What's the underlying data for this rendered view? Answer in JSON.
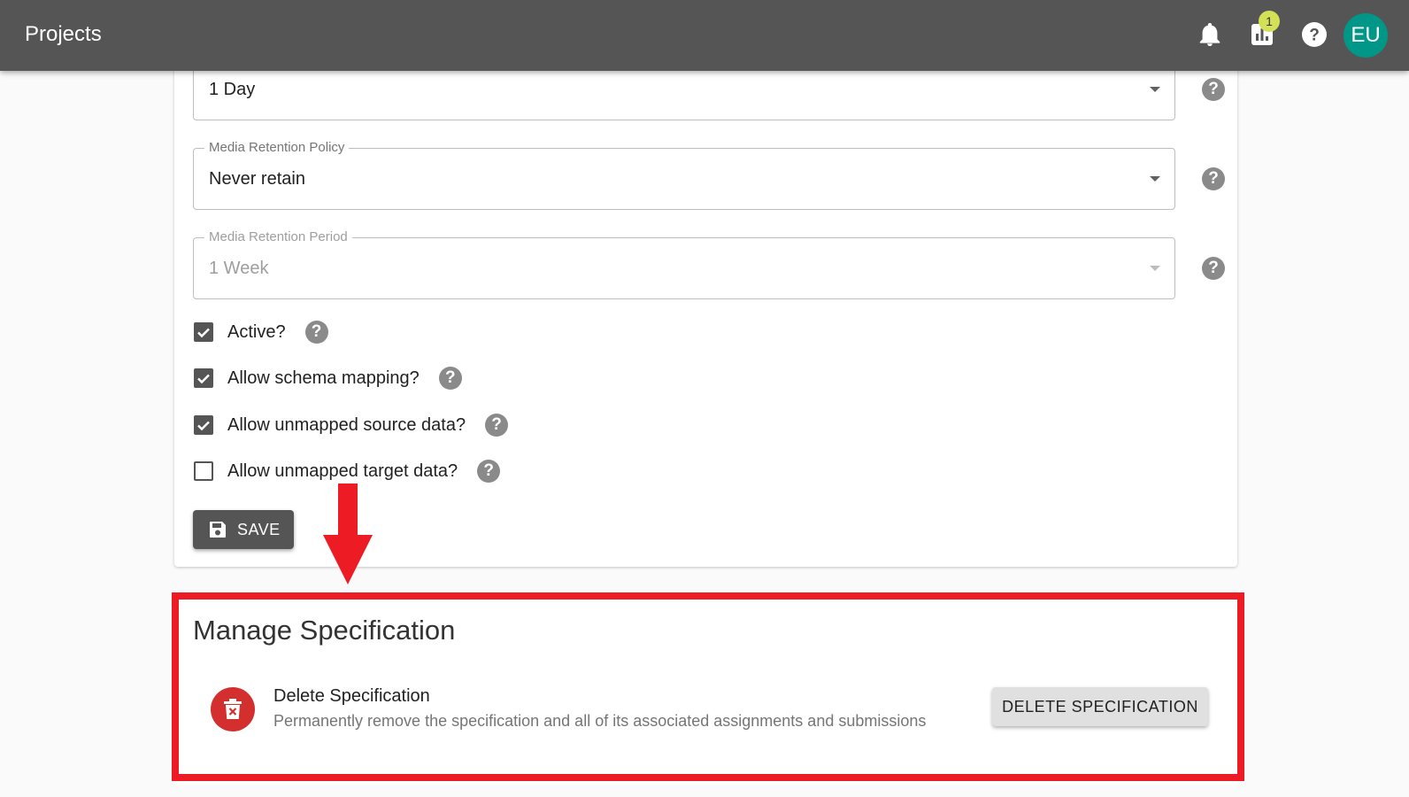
{
  "header": {
    "title": "Projects",
    "notification_badge": "1",
    "avatar_initials": "EU",
    "icons": [
      "bell-icon",
      "bar-chart-icon",
      "help-icon"
    ]
  },
  "form": {
    "top_field": {
      "value": "1 Day"
    },
    "media_retention_policy": {
      "label": "Media Retention Policy",
      "value": "Never retain"
    },
    "media_retention_period": {
      "label": "Media Retention Period",
      "value": "1 Week",
      "disabled": true
    },
    "checkboxes": [
      {
        "label": "Active?",
        "checked": true
      },
      {
        "label": "Allow schema mapping?",
        "checked": true
      },
      {
        "label": "Allow unmapped source data?",
        "checked": true
      },
      {
        "label": "Allow unmapped target data?",
        "checked": false
      }
    ],
    "save_label": "SAVE"
  },
  "manage": {
    "title": "Manage Specification",
    "delete_title": "Delete Specification",
    "delete_description": "Permanently remove the specification and all of its associated assignments and submissions",
    "delete_button": "DELETE SPECIFICATION"
  },
  "colors": {
    "appbar": "#555555",
    "avatar": "#009688",
    "badge": "#d4e157",
    "delete_icon": "#d32f2f",
    "annotation": "#ed1c24"
  }
}
